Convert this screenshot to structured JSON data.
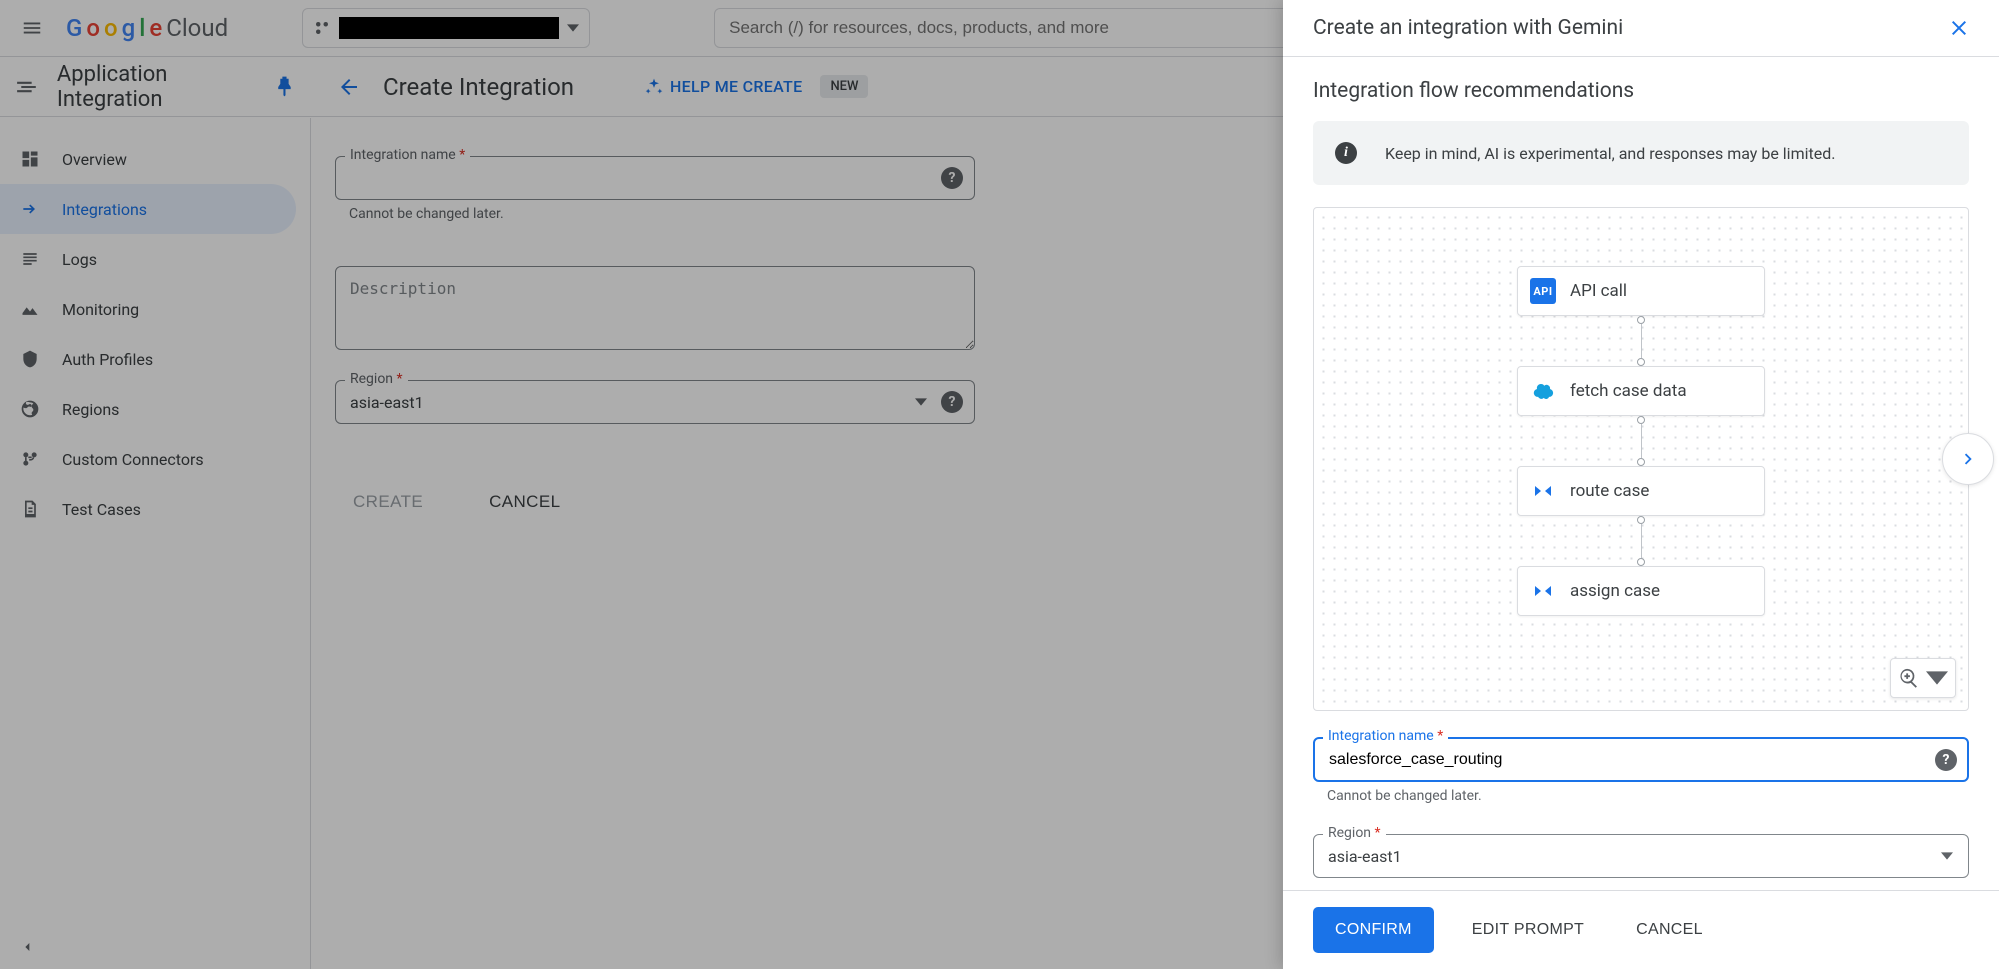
{
  "header": {
    "logo_word1": "Google",
    "logo_word2": "Cloud",
    "search_placeholder": "Search (/) for resources, docs, products, and more"
  },
  "subheader": {
    "product": "Application Integration",
    "page_title": "Create Integration",
    "help_me": "HELP ME CREATE",
    "badge": "NEW"
  },
  "sidebar": {
    "items": [
      {
        "label": "Overview"
      },
      {
        "label": "Integrations"
      },
      {
        "label": "Logs"
      },
      {
        "label": "Monitoring"
      },
      {
        "label": "Auth Profiles"
      },
      {
        "label": "Regions"
      },
      {
        "label": "Custom Connectors"
      },
      {
        "label": "Test Cases"
      }
    ]
  },
  "form": {
    "name_label": "Integration name",
    "name_helper": "Cannot be changed later.",
    "desc_placeholder": "Description",
    "region_label": "Region",
    "region_value": "asia-east1",
    "create": "CREATE",
    "cancel": "CANCEL"
  },
  "panel": {
    "title": "Create an integration with Gemini",
    "section": "Integration flow recommendations",
    "info": "Keep in mind, AI is experimental, and responses may be limited.",
    "nodes": {
      "api": "API call",
      "fetch": "fetch case data",
      "route": "route case",
      "assign": "assign case"
    },
    "name_label": "Integration name",
    "name_value": "salesforce_case_routing",
    "name_helper": "Cannot be changed later.",
    "region_label": "Region",
    "region_value": "asia-east1",
    "confirm": "CONFIRM",
    "edit": "EDIT PROMPT",
    "cancel": "CANCEL"
  }
}
